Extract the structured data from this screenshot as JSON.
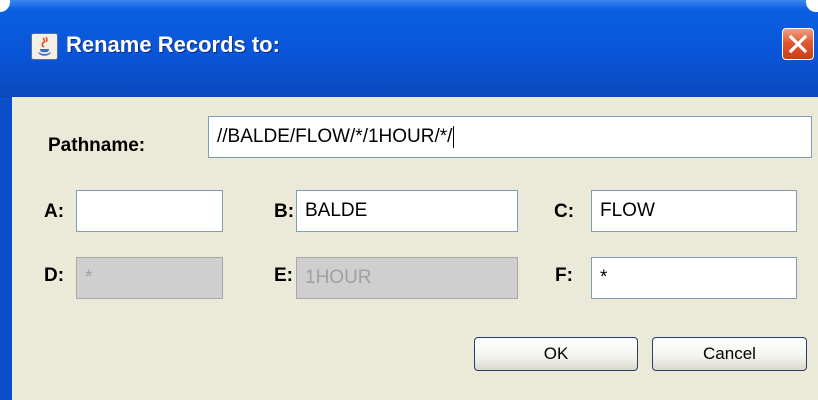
{
  "window": {
    "title": "Rename Records to:",
    "icon": "java-app-icon",
    "close_icon": "close-icon"
  },
  "form": {
    "pathname": {
      "label": "Pathname:",
      "value": "//BALDE/FLOW/*/1HOUR/*/"
    },
    "a": {
      "label": "A:",
      "value": ""
    },
    "b": {
      "label": "B:",
      "value": "BALDE"
    },
    "c": {
      "label": "C:",
      "value": "FLOW"
    },
    "d": {
      "label": "D:",
      "value": "*",
      "disabled": true
    },
    "e": {
      "label": "E:",
      "value": "1HOUR",
      "disabled": true
    },
    "f": {
      "label": "F:",
      "value": "*"
    }
  },
  "buttons": {
    "ok": "OK",
    "cancel": "Cancel"
  },
  "colors": {
    "titlebar": "#0a55d8",
    "dialog_background": "#ebe9d8",
    "close_button": "#e2582f"
  }
}
